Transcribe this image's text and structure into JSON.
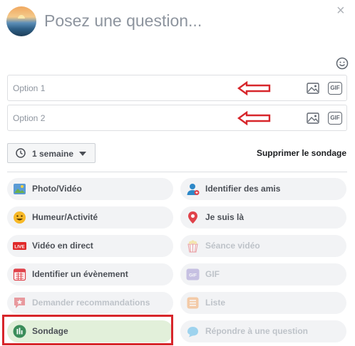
{
  "composer": {
    "question_placeholder": "Posez une question...",
    "close_glyph": "×"
  },
  "options": [
    {
      "placeholder": "Option 1",
      "gif_label": "GIF"
    },
    {
      "placeholder": "Option 2",
      "gif_label": "GIF"
    }
  ],
  "poll": {
    "duration_label": "1 semaine",
    "remove_label": "Supprimer le sondage"
  },
  "actions": {
    "left": [
      {
        "label": "Photo/Vidéo",
        "icon": "photo-video-icon"
      },
      {
        "label": "Humeur/Activité",
        "icon": "emoji-icon"
      },
      {
        "label": "Vidéo en direct",
        "icon": "live-icon"
      },
      {
        "label": "Identifier un évènement",
        "icon": "calendar-icon"
      },
      {
        "label": "Demander recommandations",
        "icon": "recommendation-icon"
      },
      {
        "label": "Sondage",
        "icon": "poll-icon"
      }
    ],
    "right": [
      {
        "label": "Identifier des amis",
        "icon": "tag-friends-icon"
      },
      {
        "label": "Je suis là",
        "icon": "location-pin-icon"
      },
      {
        "label": "Séance vidéo",
        "icon": "watch-party-icon"
      },
      {
        "label": "GIF",
        "icon": "gif-icon"
      },
      {
        "label": "Liste",
        "icon": "list-icon"
      },
      {
        "label": "Répondre à une question",
        "icon": "answer-question-icon"
      }
    ],
    "live_badge": "LIVE",
    "gif_badge": "GIF"
  },
  "colors": {
    "annotation_red": "#d7262b",
    "selected_pill": "#e2f0da",
    "poll_green": "#3b8d5a"
  }
}
